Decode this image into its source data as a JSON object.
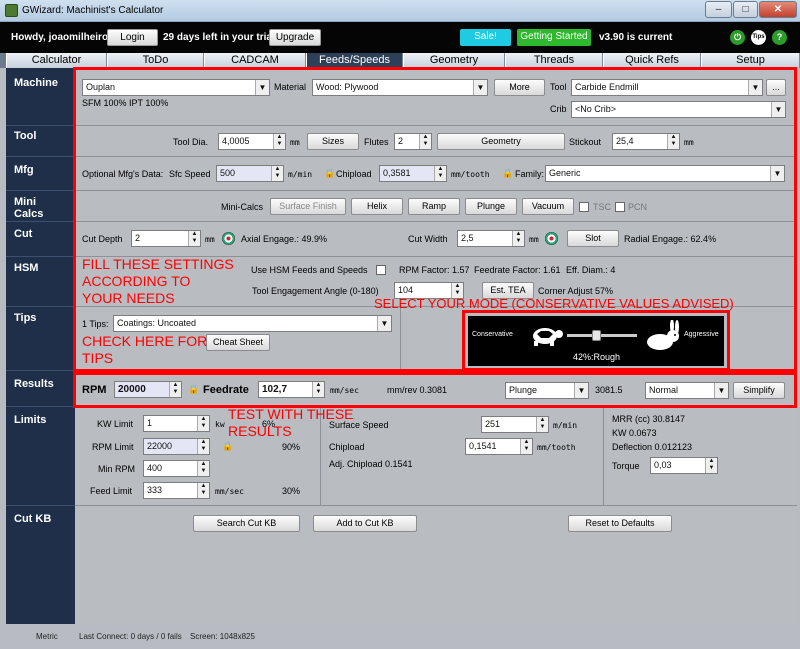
{
  "window": {
    "title": "GWizard: Machinist's Calculator",
    "min": "–",
    "max": "□",
    "close": "✕"
  },
  "topbar": {
    "greeting": "Howdy, joaomilheiro!",
    "login": "Login",
    "trial": "29 days left in your trial.",
    "upgrade": "Upgrade",
    "sale": "Sale!",
    "getting_started": "Getting Started",
    "version": "v3.90 is current",
    "icon_tips": "Tips",
    "icon_help": "?",
    "icon_power": "⏻"
  },
  "tabs": [
    "Calculator",
    "ToDo",
    "CADCAM",
    "Feeds/Speeds",
    "Geometry",
    "Threads",
    "Quick Refs",
    "Setup"
  ],
  "sidebar": [
    "Machine",
    "Tool",
    "Mfg",
    "Mini Calcs",
    "Cut",
    "HSM",
    "Tips",
    "Results",
    "Limits",
    "Cut KB"
  ],
  "machine": {
    "machine_value": "Ouplan",
    "material_label": "Material",
    "material_value": "Wood: Plywood",
    "more": "More",
    "tool_label": "Tool",
    "tool_value": "Carbide Endmill",
    "dots": "...",
    "sfm_ipt": "SFM 100%  IPT 100%",
    "crib_label": "Crib",
    "crib_value": "<No Crib>"
  },
  "tool": {
    "dia_label": "Tool Dia.",
    "dia_value": "4,0005",
    "dia_unit": "mm",
    "sizes": "Sizes",
    "flutes_label": "Flutes",
    "flutes_value": "2",
    "geometry": "Geometry",
    "stickout_label": "Stickout",
    "stickout_value": "25,4",
    "stickout_unit": "mm"
  },
  "mfg": {
    "label": "Optional Mfg's Data:",
    "sfc_label": "Sfc Speed",
    "sfc_value": "500",
    "sfc_unit": "m/min",
    "chip_label": "Chipload",
    "chip_value": "0,3581",
    "chip_unit": "mm/tooth",
    "family_label": "Family:",
    "family_value": "Generic"
  },
  "minicalcs": {
    "label": "Mini-Calcs",
    "surface": "Surface Finish",
    "helix": "Helix",
    "ramp": "Ramp",
    "plunge": "Plunge",
    "vacuum": "Vacuum",
    "tsc": "TSC",
    "pcn": "PCN"
  },
  "cut": {
    "depth_label": "Cut Depth",
    "depth_value": "2",
    "depth_unit": "mm",
    "axial": "Axial Engage.: 49.9%",
    "width_label": "Cut Width",
    "width_value": "2,5",
    "width_unit": "mm",
    "slot": "Slot",
    "radial": "Radial Engage.: 62.4%"
  },
  "hsm": {
    "use_label": "Use HSM Feeds and Speeds",
    "rpm_factor": "RPM Factor: 1.57",
    "feed_factor": "Feedrate Factor: 1.61",
    "eff_diam": "Eff. Diam.: 4",
    "angle_label": "Tool Engagement Angle (0-180)",
    "angle_value": "104",
    "est_tea": "Est. TEA",
    "corner": "Corner Adjust 57%"
  },
  "tips": {
    "count": "1 Tips:",
    "value": "Coatings: Uncoated",
    "cheat": "Cheat Sheet"
  },
  "mode": {
    "conservative": "Conservative",
    "aggressive": "Aggressive",
    "readout": "42%:Rough",
    "level": 0.42
  },
  "results": {
    "rpm_label": "RPM",
    "rpm_value": "20000",
    "feed_label": "Feedrate",
    "feed_value": "102,7",
    "feed_unit": "mm/sec",
    "mmrev": "mm/rev 0.3081",
    "op_value": "Plunge",
    "op_num": "3081.5",
    "mode_value": "Normal",
    "simplify": "Simplify"
  },
  "limits": {
    "kw_label": "KW Limit",
    "kw_value": "1",
    "kw_unit": "kw",
    "kw_pct": "6%",
    "rpm_label": "RPM Limit",
    "rpm_value": "22000",
    "rpm_pct": "90%",
    "minrpm_label": "Min RPM",
    "minrpm_value": "400",
    "feed_label": "Feed Limit",
    "feed_value": "333",
    "feed_unit": "mm/sec",
    "feed_pct": "30%",
    "surf_label": "Surface Speed",
    "surf_value": "251",
    "surf_unit": "m/min",
    "chip_label": "Chipload",
    "chip_value": "0,1541",
    "chip_unit": "mm/tooth",
    "adj_chip": "Adj. Chipload 0.1541",
    "mrr": "MRR (cc) 30.8147",
    "kw": "KW 0.0673",
    "deflection": "Deflection 0.012123",
    "torque_label": "Torque",
    "torque_value": "0,03"
  },
  "cutkb": {
    "search": "Search Cut KB",
    "add": "Add to Cut KB",
    "reset": "Reset to Defaults"
  },
  "annotations": {
    "fill1": "FILL THESE SETTINGS",
    "fill2": "ACCORDING TO",
    "fill3": "YOUR NEEDS",
    "mode": "SELECT YOUR MODE (CONSERVATIVE VALUES ADVISED)",
    "tips1": "CHECK HERE FOR",
    "tips2": "TIPS",
    "test1": "TEST WITH THESE",
    "test2": "RESULTS"
  },
  "status": {
    "units": "Metric",
    "connect": "Last Connect: 0 days / 0 fails",
    "screen": "Screen: 1048x825"
  },
  "colors": {
    "accent_red": "#ff0000",
    "sidebar": "#1f2f4a",
    "sale": "#1ecbe1",
    "getting_started": "#2db82d"
  }
}
